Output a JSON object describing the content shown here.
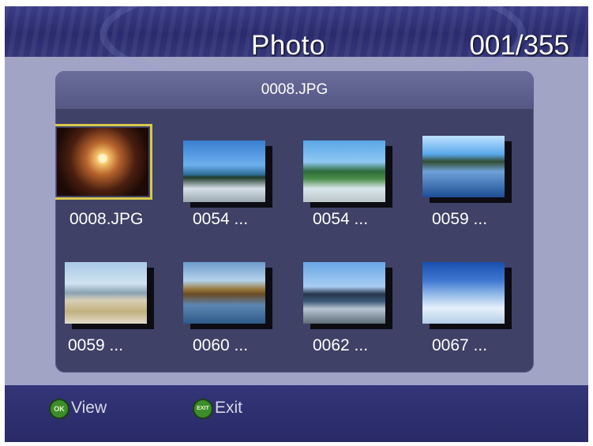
{
  "header": {
    "title": "Photo",
    "counter": "001/355"
  },
  "panel": {
    "current_file": "0008.JPG"
  },
  "thumbnails": [
    {
      "label": "0008.JPG",
      "icon": "fireworks-thumbnail",
      "selected": true
    },
    {
      "label": "0054 ...",
      "icon": "beach-rocks-thumbnail",
      "selected": false
    },
    {
      "label": "0054 ...",
      "icon": "tropical-beach-thumbnail",
      "selected": false
    },
    {
      "label": "0059 ...",
      "icon": "lake-reflection-thumbnail",
      "selected": false
    },
    {
      "label": "0059 ...",
      "icon": "shore-boulder-thumbnail",
      "selected": false
    },
    {
      "label": "0060 ...",
      "icon": "sunset-water-thumbnail",
      "selected": false
    },
    {
      "label": "0062 ...",
      "icon": "waves-rocks-thumbnail",
      "selected": false
    },
    {
      "label": "0067 ...",
      "icon": "clouds-sky-thumbnail",
      "selected": false
    }
  ],
  "footer": {
    "view_badge": "OK",
    "view_label": "View",
    "exit_badge": "EXIT",
    "exit_label": "Exit"
  },
  "colors": {
    "screen_bg": "#a2a4c6",
    "panel_bg": "#3f4166",
    "header_bg": "#2a2b6e",
    "selection": "#d9c84a",
    "badge_green": "#3c8d2a"
  }
}
